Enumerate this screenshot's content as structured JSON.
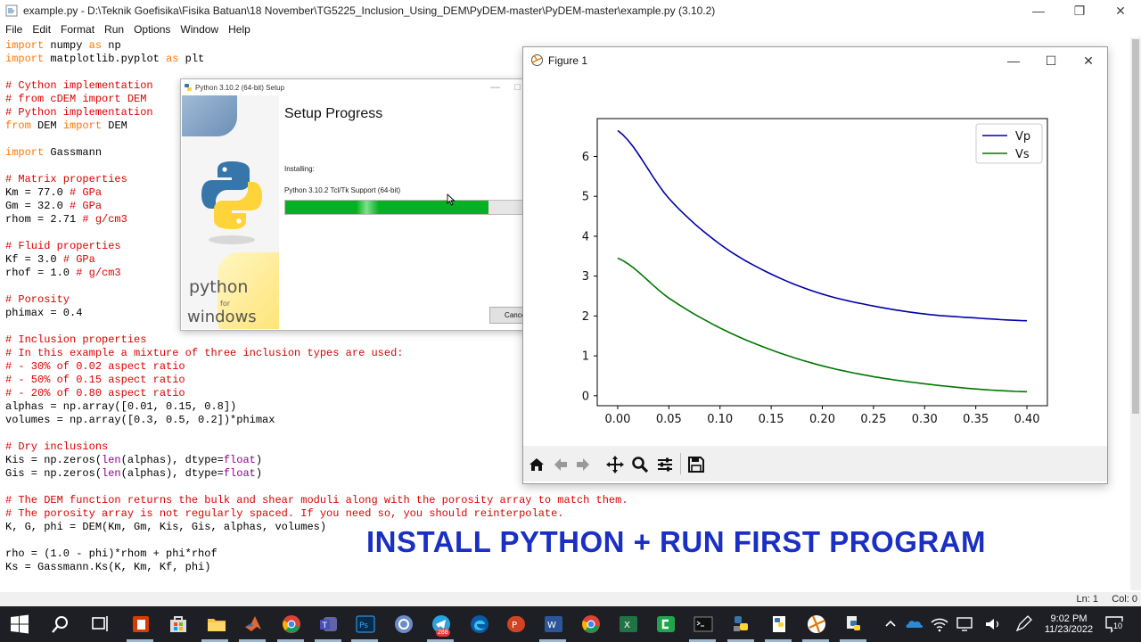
{
  "idle": {
    "title": "example.py - D:\\Teknik Goefisika\\Fisika Batuan\\18 November\\TG5225_Inclusion_Using_DEM\\PyDEM-master\\PyDEM-master\\example.py (3.10.2)",
    "menu": [
      "File",
      "Edit",
      "Format",
      "Run",
      "Options",
      "Window",
      "Help"
    ],
    "status": {
      "ln": "Ln: 1",
      "col": "Col: 0"
    },
    "code": [
      "import numpy as np",
      "import matplotlib.pyplot as plt",
      "",
      "# Cython implementation",
      "# from cDEM import DEM",
      "# Python implementation",
      "from DEM import DEM",
      "",
      "import Gassmann",
      "",
      "# Matrix properties",
      "Km = 77.0 # GPa",
      "Gm = 32.0 # GPa",
      "rhom = 2.71 # g/cm3",
      "",
      "# Fluid properties",
      "Kf = 3.0 # GPa",
      "rhof = 1.0 # g/cm3",
      "",
      "# Porosity",
      "phimax = 0.4",
      "",
      "# Inclusion properties",
      "# In this example a mixture of three inclusion types are used:",
      "# - 30% of 0.02 aspect ratio",
      "# - 50% of 0.15 aspect ratio",
      "# - 20% of 0.80 aspect ratio",
      "alphas = np.array([0.01, 0.15, 0.8])",
      "volumes = np.array([0.3, 0.5, 0.2])*phimax",
      "",
      "# Dry inclusions",
      "Kis = np.zeros(len(alphas), dtype=float)",
      "Gis = np.zeros(len(alphas), dtype=float)",
      "",
      "# The DEM function returns the bulk and shear moduli along with the porosity array to match them.",
      "# The porosity array is not regularly spaced. If you need so, you should reinterpolate.",
      "K, G, phi = DEM(Km, Gm, Kis, Gis, alphas, volumes)",
      "",
      "rho = (1.0 - phi)*rhom + phi*rhof",
      "Ks = Gassmann.Ks(K, Km, Kf, phi)"
    ]
  },
  "banner": "INSTALL PYTHON + RUN FIRST PROGRAM",
  "setup": {
    "title": "Python 3.10.2 (64-bit) Setup",
    "heading": "Setup Progress",
    "installing": "Installing:",
    "package": "Python 3.10.2 Tcl/Tk Support (64-bit)",
    "progress": 0.79,
    "cancel": "Cancel",
    "side_text_1": "python",
    "side_text_2": "for",
    "side_text_3": "windows"
  },
  "figure": {
    "title": "Figure 1"
  },
  "chart_data": {
    "type": "line",
    "x": [
      0.0,
      0.05,
      0.1,
      0.15,
      0.2,
      0.25,
      0.3,
      0.35,
      0.4
    ],
    "series": [
      {
        "name": "Vp",
        "color": "#0000aa",
        "values": [
          6.65,
          4.95,
          3.8,
          3.05,
          2.55,
          2.25,
          2.05,
          1.95,
          1.88
        ]
      },
      {
        "name": "Vs",
        "color": "#007700",
        "values": [
          3.45,
          2.45,
          1.7,
          1.15,
          0.75,
          0.48,
          0.3,
          0.17,
          0.1
        ]
      }
    ],
    "xticks": [
      "0.00",
      "0.05",
      "0.10",
      "0.15",
      "0.20",
      "0.25",
      "0.30",
      "0.35",
      "0.40"
    ],
    "yticks": [
      "0",
      "1",
      "2",
      "3",
      "4",
      "5",
      "6"
    ],
    "xlim": [
      -0.02,
      0.42
    ],
    "ylim": [
      -0.25,
      6.95
    ],
    "legend": "top-right",
    "title": "",
    "xlabel": "",
    "ylabel": ""
  },
  "taskbar": {
    "time": "9:02 PM",
    "date": "11/23/2022",
    "notification_count": "10",
    "telegram_badge": "288"
  }
}
